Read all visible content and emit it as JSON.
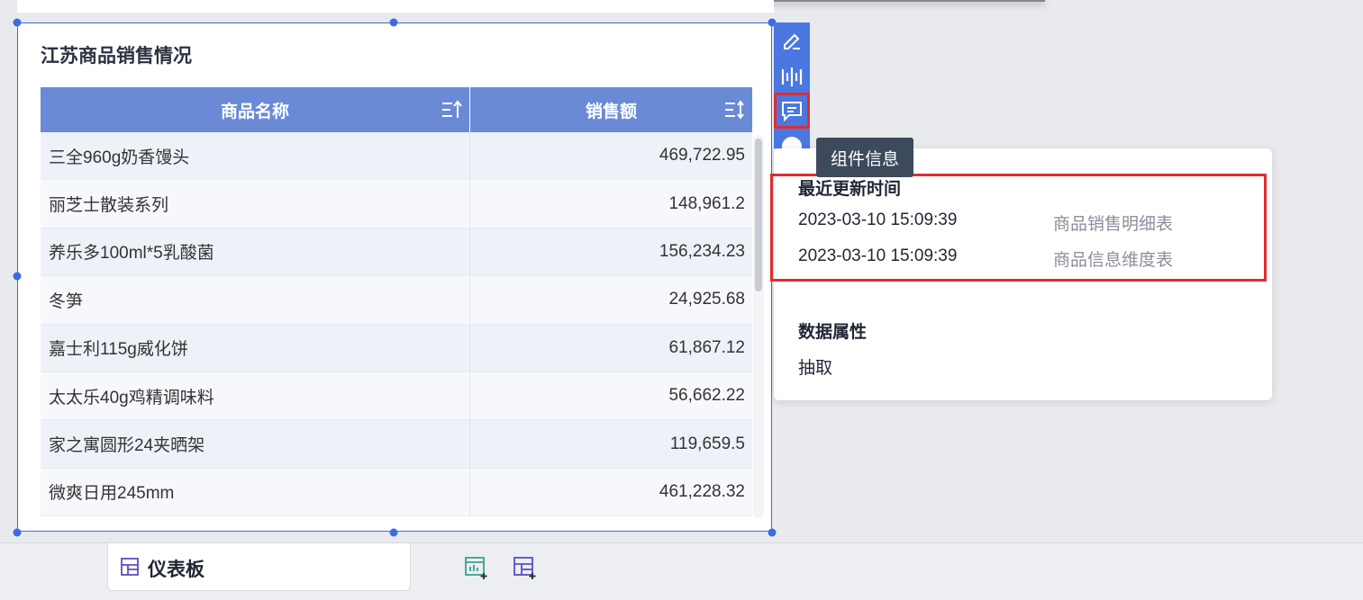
{
  "widget": {
    "title": "江苏商品销售情况",
    "columns": [
      "商品名称",
      "销售额"
    ],
    "rows": [
      {
        "name": "三全960g奶香馒头",
        "sales": "469,722.95"
      },
      {
        "name": "丽芝士散装系列",
        "sales": "148,961.2"
      },
      {
        "name": "养乐多100ml*5乳酸菌",
        "sales": "156,234.23"
      },
      {
        "name": "冬笋",
        "sales": "24,925.68"
      },
      {
        "name": "嘉士利115g威化饼",
        "sales": "61,867.12"
      },
      {
        "name": "太太乐40g鸡精调味料",
        "sales": "56,662.22"
      },
      {
        "name": "家之寓圆形24夹晒架",
        "sales": "119,659.5"
      },
      {
        "name": "微爽日用245mm",
        "sales": "461,228.32"
      }
    ]
  },
  "toolbar": {
    "items": [
      {
        "icon": "edit-icon"
      },
      {
        "icon": "chart-columns-icon"
      },
      {
        "icon": "comment-icon",
        "active": true
      },
      {
        "icon": "globe-icon"
      }
    ],
    "tooltip": "组件信息"
  },
  "info": {
    "update_heading": "最近更新时间",
    "updates": [
      {
        "time": "2023-03-10 15:09:39",
        "source": "商品销售明细表"
      },
      {
        "time": "2023-03-10 15:09:39",
        "source": "商品信息维度表"
      }
    ],
    "attr_heading": "数据属性",
    "attr_value": "抽取"
  },
  "bottom": {
    "tab_label": "仪表板",
    "icons": [
      "add-chart-icon",
      "add-dashboard-icon"
    ]
  },
  "colors": {
    "accent": "#3b6de0",
    "header": "#6a8ad6",
    "highlight": "#e02c2c",
    "tooltip_bg": "#3d4a5c"
  }
}
